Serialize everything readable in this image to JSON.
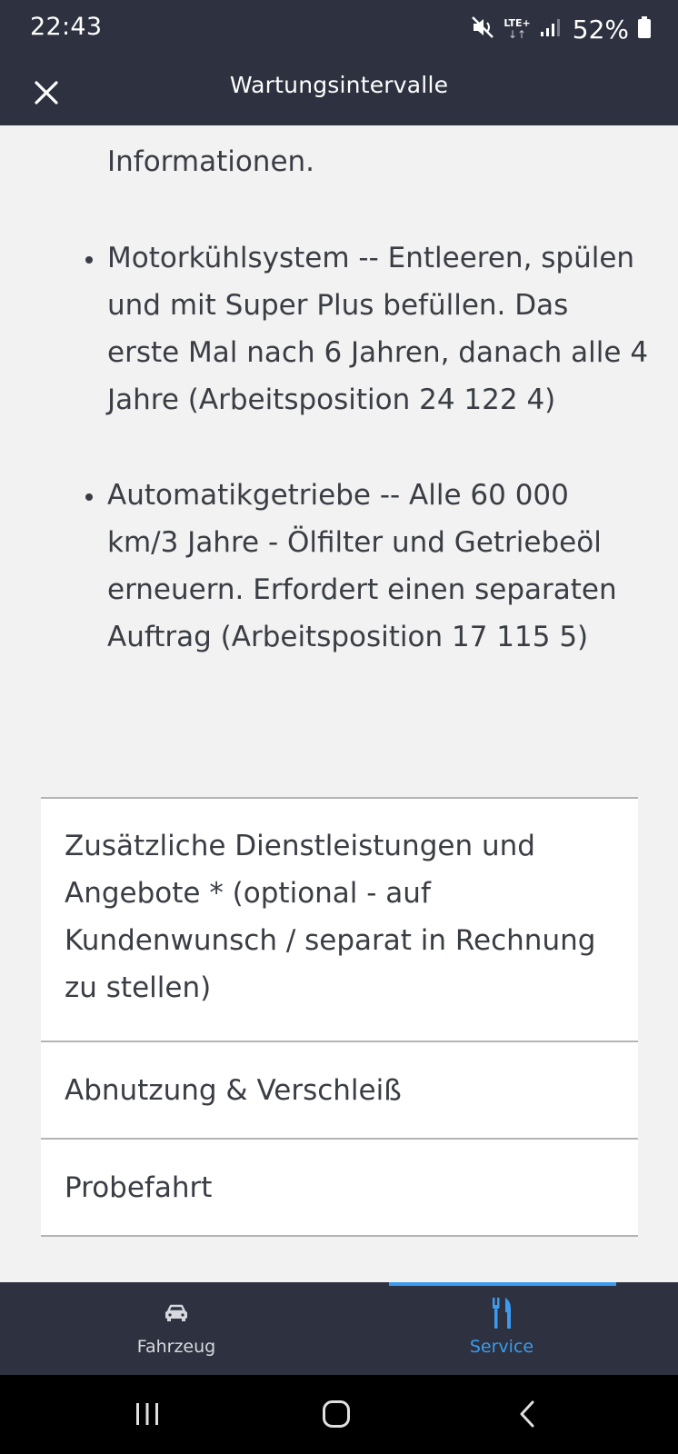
{
  "status_bar": {
    "time": "22:43",
    "network": "LTE+",
    "battery": "52%",
    "icons": [
      "mute-vibrate-icon",
      "data-arrows-icon",
      "signal-icon",
      "battery-icon"
    ]
  },
  "app_bar": {
    "title": "Wartungsintervalle",
    "close_icon": "close-icon"
  },
  "content": {
    "top_fragment": "Informationen.",
    "bullets": [
      "Motorkühlsystem -- Entleeren, spülen und mit Super Plus befüllen. Das erste Mal nach 6 Jahren, danach alle 4 Jahre (Arbeitsposition 24 122 4)",
      "Automatikgetriebe -- Alle 60 000 km/3 Jahre - Ölfilter und Getriebeöl erneuern. Erfordert einen separaten Auftrag (Arbeitsposition 17 115 5)"
    ]
  },
  "sections": [
    "Zusätzliche Dienstleistungen und Angebote * (optional - auf Kundenwunsch / separat in Rechnung zu stellen)",
    "Abnutzung & Verschleiß",
    "Probefahrt"
  ],
  "bottom_nav": {
    "items": [
      {
        "label": "Fahrzeug",
        "icon": "car-icon",
        "active": false
      },
      {
        "label": "Service",
        "icon": "tools-icon",
        "active": true
      }
    ]
  },
  "colors": {
    "bar_background": "#2e3240",
    "content_background": "#f2f2f2",
    "accent": "#3a9bf0",
    "text": "#3a3d44"
  }
}
